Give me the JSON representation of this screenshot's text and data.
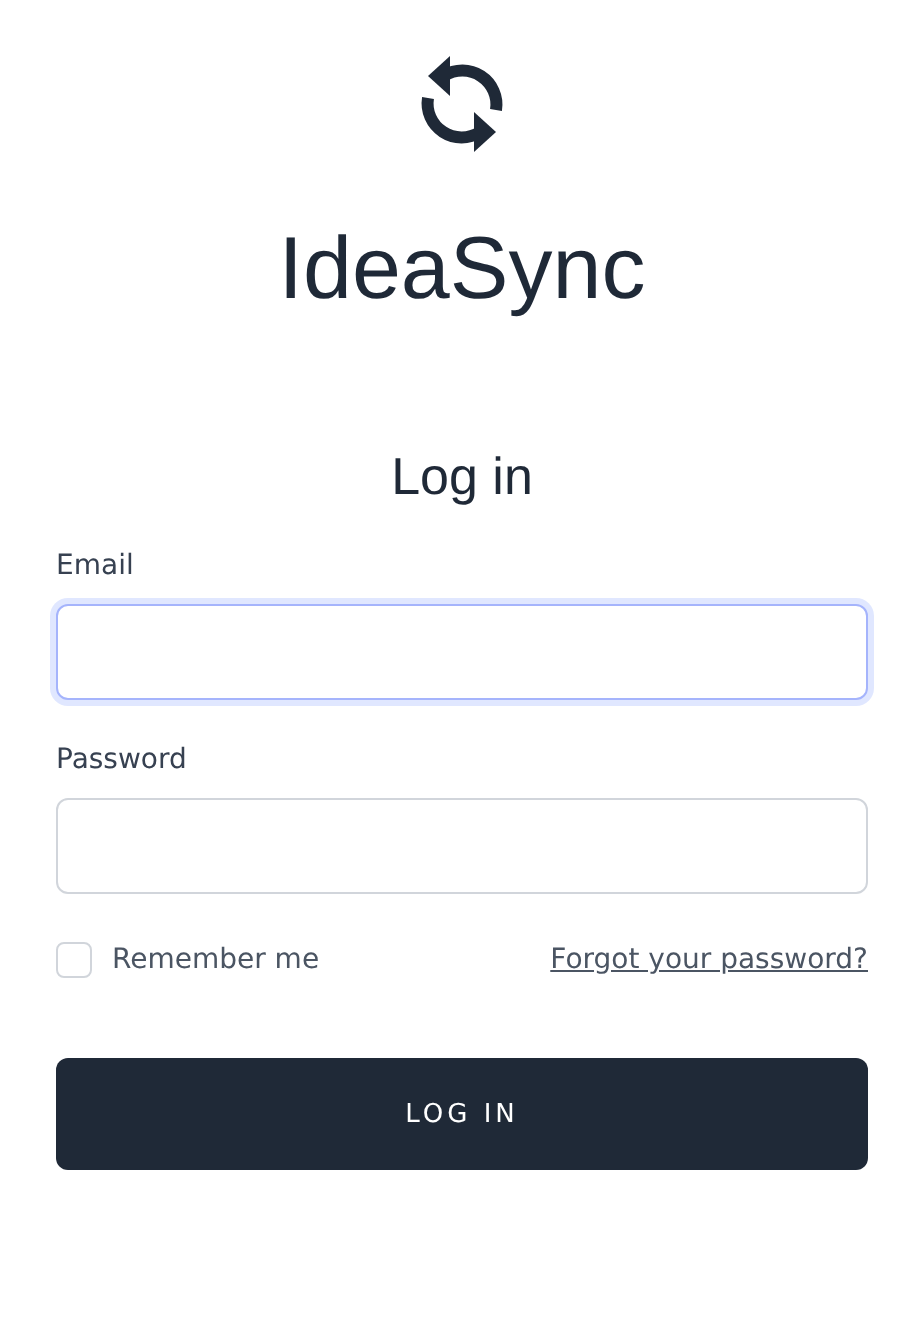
{
  "app": {
    "name": "IdeaSync"
  },
  "heading": "Log in",
  "fields": [
    {
      "label": "Email",
      "focused": true
    },
    {
      "label": "Password",
      "focused": false
    }
  ],
  "remember": {
    "label": "Remember me",
    "checked": false
  },
  "forgot_link": "Forgot your password?",
  "submit": "LOG IN"
}
